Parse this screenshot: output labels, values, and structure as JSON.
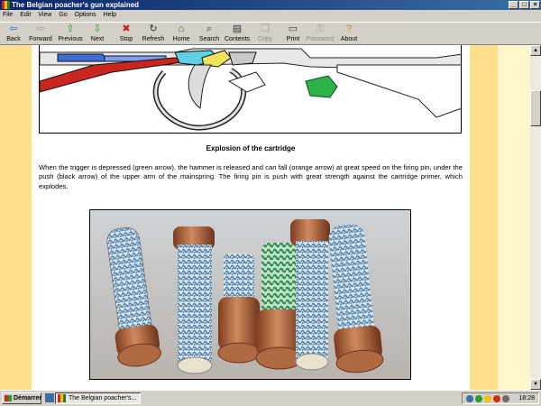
{
  "window": {
    "title": "The Belgian poacher's gun explained"
  },
  "menu": [
    "File",
    "Edit",
    "View",
    "Go",
    "Options",
    "Help"
  ],
  "toolbar": [
    {
      "label": "Back",
      "icon": "back-arrow-icon",
      "glyph": "⇦",
      "color": "#1f6fb5",
      "enabled": true
    },
    {
      "label": "Forward",
      "icon": "forward-arrow-icon",
      "glyph": "⇨",
      "color": "#a0a0a0",
      "enabled": false
    },
    {
      "label": "Previous",
      "icon": "up-arrow-icon",
      "glyph": "⇧",
      "color": "#1e9a2a",
      "enabled": true
    },
    {
      "label": "Next",
      "icon": "down-arrow-icon",
      "glyph": "⇩",
      "color": "#1e9a2a",
      "enabled": true
    },
    {
      "label": "Stop",
      "icon": "stop-icon",
      "glyph": "✖",
      "color": "#d11a1a",
      "enabled": true
    },
    {
      "label": "Refresh",
      "icon": "refresh-icon",
      "glyph": "↻",
      "color": "#333333",
      "enabled": true
    },
    {
      "label": "Home",
      "icon": "home-icon",
      "glyph": "⌂",
      "color": "#6a4a2a",
      "enabled": true
    },
    {
      "label": "Search",
      "icon": "search-icon",
      "glyph": "⌕",
      "color": "#333333",
      "enabled": true
    },
    {
      "label": "Contents",
      "icon": "contents-icon",
      "glyph": "▤",
      "color": "#333333",
      "enabled": true
    },
    {
      "label": "Copy",
      "icon": "copy-icon",
      "glyph": "❐",
      "color": "#a0a0a0",
      "enabled": false
    },
    {
      "label": "Print",
      "icon": "print-icon",
      "glyph": "▭",
      "color": "#333333",
      "enabled": true
    },
    {
      "label": "Password",
      "icon": "password-icon",
      "glyph": "⚿",
      "color": "#a0a0a0",
      "enabled": false
    },
    {
      "label": "About",
      "icon": "about-icon",
      "glyph": "?",
      "color": "#c08a10",
      "enabled": true
    }
  ],
  "content": {
    "caption": "Explosion of the cartridge",
    "paragraph": "When the trigger is depressed (green arrow), the hammer is released and can fall (orange arrow) at great speed on the firing pin, under the push (black arrow) of the upper arm of the mainspring. The firing pin is push with great strength against the cartridge primer, which explodes."
  },
  "colors": {
    "page_band": "#ffdf8c",
    "page_bg": "#fff7c9",
    "shell_blue": "#4b7fa8",
    "shell_green": "#2f8a4f",
    "shell_brass": "#b2623a"
  },
  "taskbar": {
    "start_label": "Démarrer",
    "task_label": "The Belgian poacher's...",
    "clock": "18:28"
  }
}
